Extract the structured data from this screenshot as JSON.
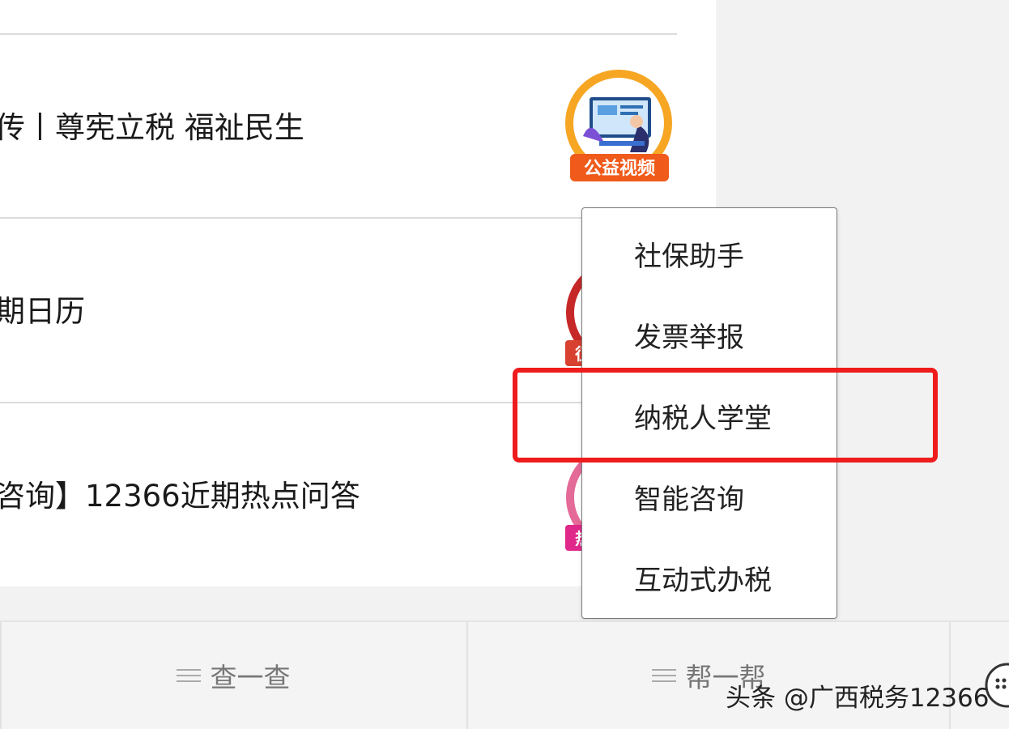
{
  "articles": [
    {
      "title": "传丨尊宪立税 福祉民生",
      "badge": "公益视频",
      "badge_color": "#f07a1a"
    },
    {
      "title": "期日历",
      "badge": "征",
      "badge_color": "#c62828"
    },
    {
      "title": "咨询】12366近期热点问答",
      "badge": "热",
      "badge_color": "#e0447a"
    }
  ],
  "popup_menu": {
    "items": [
      {
        "label": "社保助手"
      },
      {
        "label": "发票举报"
      },
      {
        "label": "纳税人学堂",
        "highlighted": true
      },
      {
        "label": "智能咨询"
      },
      {
        "label": "互动式办税"
      }
    ],
    "highlight_color": "#ee1c1c"
  },
  "tabbar": {
    "tabs": [
      {
        "label": "查一查"
      },
      {
        "label": "帮一帮"
      }
    ]
  },
  "watermark": "头条 @广西税务12366"
}
